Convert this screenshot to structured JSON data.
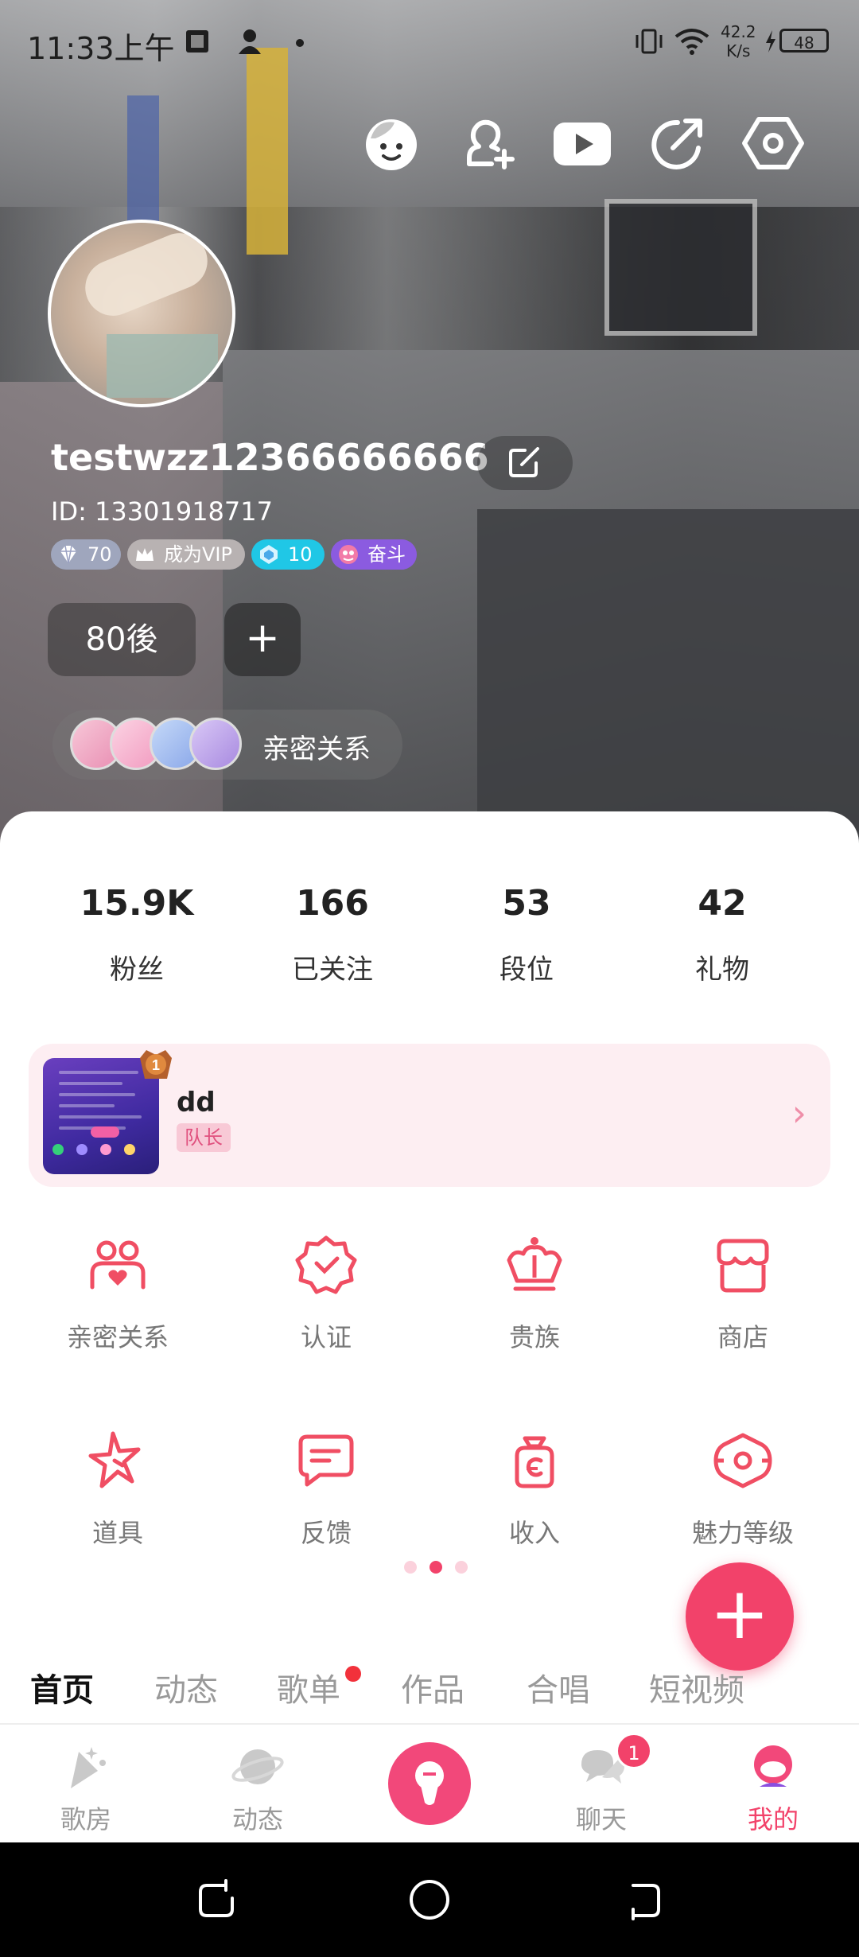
{
  "status_bar": {
    "time": "11:33上午",
    "net_speed_value": "42.2",
    "net_speed_unit": "K/s",
    "battery": "48"
  },
  "top_icons": [
    "face-icon",
    "add-friend-icon",
    "video-play-icon",
    "share-icon",
    "settings-icon"
  ],
  "profile": {
    "username": "testwzz12366666666",
    "id_text": "ID: 13301918717",
    "badges": {
      "diamond_level": "70",
      "vip_label": "成为VIP",
      "crystal_level": "10",
      "rank_label": "奋斗"
    },
    "tag": "80後",
    "tag_add": "+",
    "intimacy_label": "亲密关系"
  },
  "stats": [
    {
      "value": "15.9K",
      "label": "粉丝"
    },
    {
      "value": "166",
      "label": "已关注"
    },
    {
      "value": "53",
      "label": "段位"
    },
    {
      "value": "42",
      "label": "礼物"
    }
  ],
  "family": {
    "rank": "1",
    "name": "dd",
    "role": "队长",
    "arrow": "›"
  },
  "grid": [
    {
      "label": "亲密关系",
      "icon": "couple-icon"
    },
    {
      "label": "认证",
      "icon": "badge-check-icon"
    },
    {
      "label": "贵族",
      "icon": "crown-icon"
    },
    {
      "label": "商店",
      "icon": "shop-icon"
    },
    {
      "label": "道具",
      "icon": "star-icon"
    },
    {
      "label": "反馈",
      "icon": "feedback-icon"
    },
    {
      "label": "收入",
      "icon": "income-bag-icon"
    },
    {
      "label": "魅力等级",
      "icon": "charm-level-icon"
    }
  ],
  "fab": "+",
  "tabs": [
    {
      "label": "首页",
      "active": true
    },
    {
      "label": "动态"
    },
    {
      "label": "歌单",
      "dot": true
    },
    {
      "label": "作品"
    },
    {
      "label": "合唱"
    },
    {
      "label": "短视频"
    }
  ],
  "bottom_nav": [
    {
      "label": "歌房",
      "icon": "party-icon"
    },
    {
      "label": "动态",
      "icon": "planet-icon"
    },
    {
      "label": "",
      "icon": "microphone-icon"
    },
    {
      "label": "聊天",
      "icon": "chat-icon",
      "badge": "1"
    },
    {
      "label": "我的",
      "icon": "me-icon",
      "active": true
    }
  ],
  "colors": {
    "accent": "#f2426a",
    "family_bg": "#fdeef2",
    "grid_icon": "#f04e63"
  }
}
